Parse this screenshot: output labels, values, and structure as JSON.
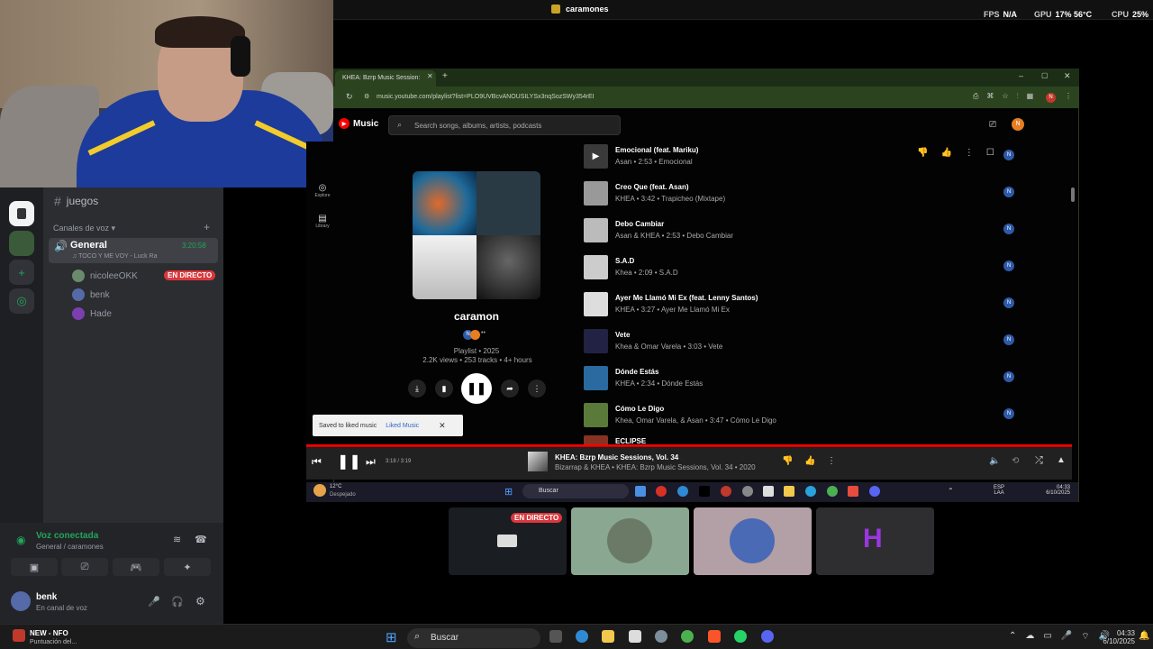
{
  "overlay": {
    "stream_title": "caramones",
    "fps_label": "FPS",
    "fps_value": "N/A",
    "gpu_label": "GPU",
    "gpu_value": "17% 56°C",
    "cpu_label": "CPU",
    "cpu_value": "25%"
  },
  "discord": {
    "text_channel": "juegos",
    "voice_section": "Canales de voz",
    "voice_channel": "General",
    "voice_timer": "3:20:58",
    "now_playing": "TOCO Y ME VOY - Luck Ra",
    "users": [
      {
        "name": "nicoleeOKK",
        "live": "EN DIRECTO"
      },
      {
        "name": "benk"
      },
      {
        "name": "Hade"
      }
    ],
    "voice_status": "Voz conectada",
    "voice_location": "General / caramones",
    "user_name": "benk",
    "user_status": "En canal de voz",
    "stream_live_badge": "EN DIRECTO",
    "hade_initial": "H"
  },
  "browser": {
    "tab_title": "KHEA: Bzrp Music Session:",
    "url": "music.youtube.com/playlist?list=PLO9UVBcvANOUSILYSx3nqSozSWy354rEI",
    "user_initial": "N"
  },
  "ytmusic": {
    "logo": "Music",
    "search_placeholder": "Search songs, albums, artists, podcasts",
    "nav": [
      {
        "label": "Explore",
        "icon": "compass-icon"
      },
      {
        "label": "Library",
        "icon": "library-icon"
      }
    ],
    "playlist": {
      "name": "caramon",
      "meta1": "Playlist • 2025",
      "meta2": "2.2K views • 253 tracks • 4+ hours"
    },
    "toast": {
      "text": "Saved to liked music",
      "link": "Liked Music"
    },
    "tracks": [
      {
        "title": "Emocional (feat. Mariku)",
        "subtitle": "Asan • 2:53 • Emocional",
        "color": "#3a3a3a"
      },
      {
        "title": "Creo Que (feat. Asan)",
        "subtitle": "KHEA • 3:42 • Trapicheo (Mixtape)",
        "color": "#999999"
      },
      {
        "title": "Debo Cambiar",
        "subtitle": "Asan & KHEA • 2:53 • Debo Cambiar",
        "color": "#bbbbbb"
      },
      {
        "title": "S.A.D",
        "subtitle": "Khea • 2:09 • S.A.D",
        "color": "#cccccc"
      },
      {
        "title": "Ayer Me Llamó Mi Ex (feat. Lenny Santos)",
        "subtitle": "KHEA • 3:27 • Ayer Me Llamó Mi Ex",
        "color": "#dddddd"
      },
      {
        "title": "Vete",
        "subtitle": "Khea & Omar Varela • 3:03 • Vete",
        "color": "#222244"
      },
      {
        "title": "Dónde Estás",
        "subtitle": "KHEA • 2:34 • Dónde Estás",
        "color": "#2a6aa0"
      },
      {
        "title": "Cómo Le Digo",
        "subtitle": "Khea, Omar Varela, & Asan • 3:47 • Cómo Le Digo",
        "color": "#5a7a3a"
      },
      {
        "title": "ECLIPSE",
        "subtitle": "",
        "color": "#883322"
      }
    ],
    "player": {
      "time": "3:18 / 3:19",
      "title": "KHEA: Bzrp Music Sessions, Vol. 34",
      "subtitle": "Bizarrap & KHEA • KHEA: Bzrp Music Sessions, Vol. 34 • 2020"
    }
  },
  "inner_taskbar": {
    "weather_temp": "12°C",
    "weather_desc": "Despejado",
    "search": "Buscar",
    "lang": "ESP",
    "region": "LAA",
    "time": "04:33",
    "date": "6/10/2025"
  },
  "taskbar": {
    "notif_title": "NEW - NFO",
    "notif_sub": "Puntuación del...",
    "search": "Buscar",
    "time": "04:33",
    "date": "6/10/2025"
  }
}
